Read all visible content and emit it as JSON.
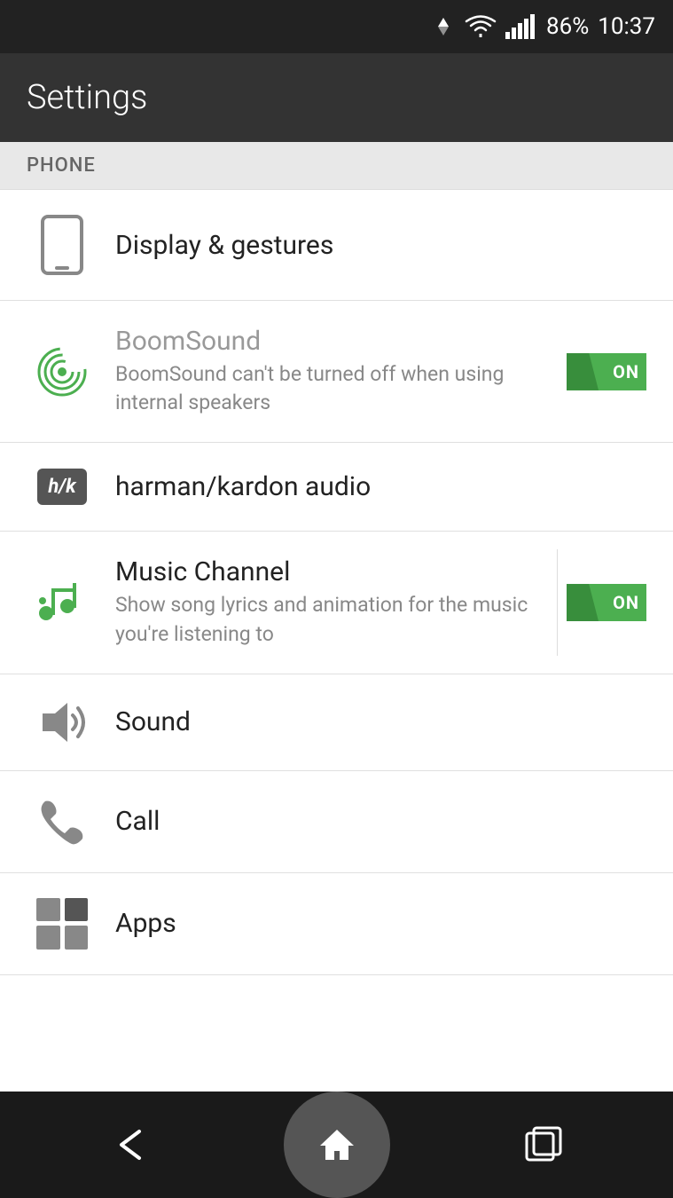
{
  "statusBar": {
    "battery": "86%",
    "time": "10:37"
  },
  "header": {
    "title": "Settings"
  },
  "sectionHeader": "PHONE",
  "items": [
    {
      "id": "display-gestures",
      "title": "Display & gestures",
      "subtitle": null,
      "toggle": null
    },
    {
      "id": "boomsound",
      "title": "BoomSound",
      "subtitle": "BoomSound can't be turned off when using internal speakers",
      "toggle": "ON",
      "titleMuted": true
    },
    {
      "id": "harman-kardon",
      "title": "harman/kardon audio",
      "subtitle": null,
      "toggle": null
    },
    {
      "id": "music-channel",
      "title": "Music Channel",
      "subtitle": "Show song lyrics and animation for the music you're listening to",
      "toggle": "ON"
    },
    {
      "id": "sound",
      "title": "Sound",
      "subtitle": null,
      "toggle": null
    },
    {
      "id": "call",
      "title": "Call",
      "subtitle": null,
      "toggle": null
    },
    {
      "id": "apps",
      "title": "Apps",
      "subtitle": null,
      "toggle": null
    }
  ],
  "navBar": {
    "back": "←",
    "home": "⌂",
    "recents": "▣"
  }
}
